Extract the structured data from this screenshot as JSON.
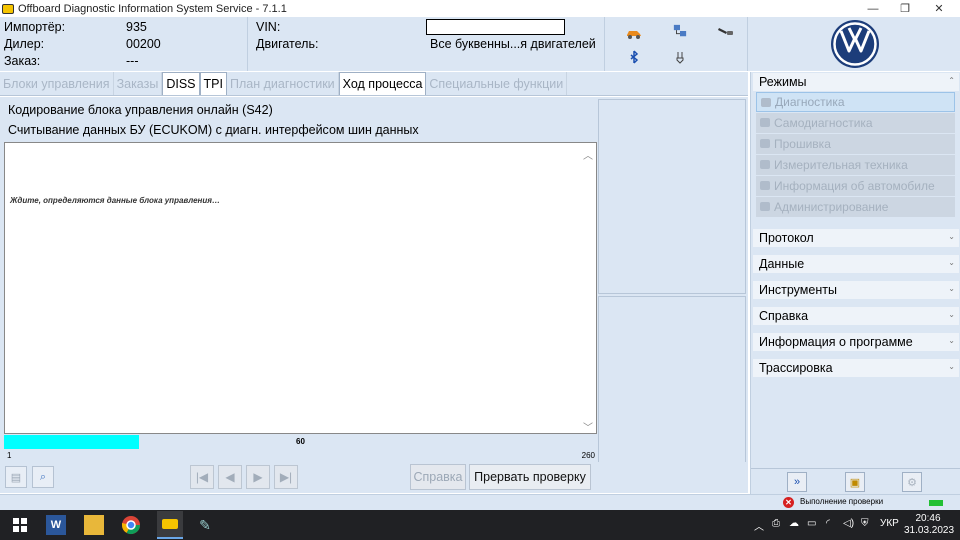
{
  "window": {
    "title": "Offboard Diagnostic Information System Service - 7.1.1",
    "min_icon": "minimize-icon",
    "max_icon": "maximize-icon",
    "close_icon": "close-icon"
  },
  "header": {
    "importer_label": "Импортёр:",
    "importer_value": "935",
    "dealer_label": "Дилер:",
    "dealer_value": "00200",
    "order_label": "Заказ:",
    "order_value": "---",
    "vin_label": "VIN:",
    "vin_value": "",
    "engine_label": "Двигатель:",
    "engine_value": "Все буквенны...я двигателей"
  },
  "tabs": [
    {
      "label": "Блоки управления",
      "state": "disabled"
    },
    {
      "label": "Заказы",
      "state": "disabled"
    },
    {
      "label": "DISS",
      "state": "enabled"
    },
    {
      "label": "TPI",
      "state": "enabled"
    },
    {
      "label": "План диагностики",
      "state": "disabled"
    },
    {
      "label": "Ход процесса",
      "state": "active"
    },
    {
      "label": "Специальные функции",
      "state": "disabled"
    }
  ],
  "process": {
    "title_line1": "Кодирование блока управления онлайн (S42)",
    "title_line2": "Считывание данных БУ (ECUKOM) с диагн. интерфейсом шин данных",
    "log_message": "Ждите, определяются данные блока управления…",
    "progress_value": 60,
    "progress_min": 1,
    "progress_max": 260,
    "progress_label": "60"
  },
  "toolbar": {
    "help_label": "Справка",
    "abort_label": "Прервать проверку"
  },
  "sidebar": {
    "modes_header": "Режимы",
    "modes": [
      "Диагностика",
      "Самодиагностика",
      "Прошивка",
      "Измерительная техника",
      "Информация об автомобиле",
      "Администрирование"
    ],
    "sections": [
      "Протокол",
      "Данные",
      "Инструменты",
      "Справка",
      "Информация о программе",
      "Трассировка"
    ]
  },
  "statusbar": {
    "text": "Выполнение проверки"
  },
  "taskbar": {
    "lang": "УКР",
    "time": "20:46",
    "date": "31.03.2023"
  },
  "colors": {
    "panel_bg": "#dbe6f3",
    "progress_fill": "#00ffff",
    "status_error": "#d62020",
    "status_ok": "#22c033"
  }
}
